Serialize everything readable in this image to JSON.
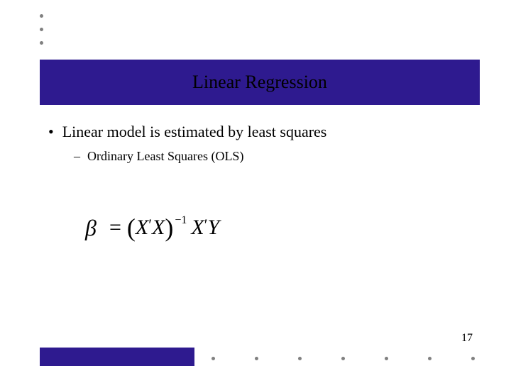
{
  "title": "Linear Regression",
  "bullets": [
    {
      "text": "Linear model is estimated by least squares",
      "sub": [
        {
          "text": "Ordinary Least Squares (OLS)"
        }
      ]
    }
  ],
  "formula": {
    "lhs": "β",
    "eq": "=",
    "lparen": "(",
    "x1": "X",
    "prime1": "′",
    "x2": "X",
    "rparen": ")",
    "exp": "−1",
    "x3": "X",
    "prime2": "′",
    "y": "Y"
  },
  "page_number": "17"
}
